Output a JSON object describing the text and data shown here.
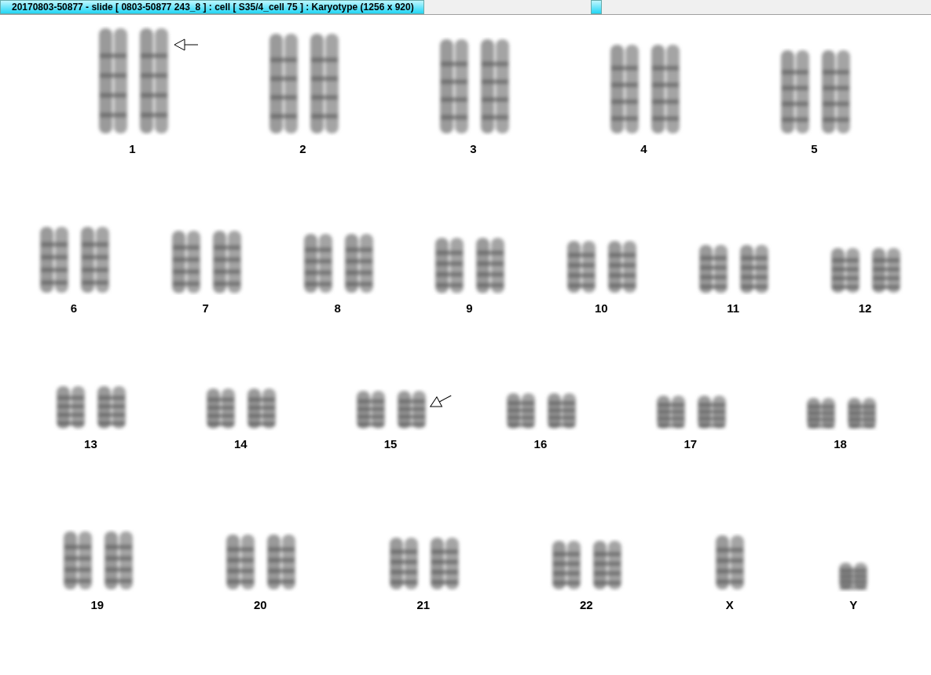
{
  "window": {
    "title": "20170803-50877 - slide [ 0803-50877 243_8 ] : cell [ S35/4_cell 75 ] : Karyotype  (1256 x 920)"
  },
  "karyotype": {
    "rows": [
      {
        "groups": [
          {
            "label": "1",
            "kind": "pair",
            "marked": true
          },
          {
            "label": "2",
            "kind": "pair",
            "marked": false
          },
          {
            "label": "3",
            "kind": "pair",
            "marked": false
          },
          {
            "label": "4",
            "kind": "pair",
            "marked": false
          },
          {
            "label": "5",
            "kind": "pair",
            "marked": false
          }
        ]
      },
      {
        "groups": [
          {
            "label": "6",
            "kind": "pair",
            "marked": false
          },
          {
            "label": "7",
            "kind": "pair",
            "marked": false
          },
          {
            "label": "8",
            "kind": "pair",
            "marked": false
          },
          {
            "label": "9",
            "kind": "pair",
            "marked": false
          },
          {
            "label": "10",
            "kind": "pair",
            "marked": false
          },
          {
            "label": "11",
            "kind": "pair",
            "marked": false
          },
          {
            "label": "12",
            "kind": "pair",
            "marked": false
          }
        ]
      },
      {
        "groups": [
          {
            "label": "13",
            "kind": "pair",
            "marked": false
          },
          {
            "label": "14",
            "kind": "pair",
            "marked": false
          },
          {
            "label": "15",
            "kind": "pair",
            "marked": true
          },
          {
            "label": "16",
            "kind": "pair",
            "marked": false
          },
          {
            "label": "17",
            "kind": "pair",
            "marked": false
          },
          {
            "label": "18",
            "kind": "pair",
            "marked": false
          }
        ]
      },
      {
        "groups": [
          {
            "label": "19",
            "kind": "pair",
            "marked": false
          },
          {
            "label": "20",
            "kind": "pair",
            "marked": false
          },
          {
            "label": "21",
            "kind": "pair",
            "marked": false
          },
          {
            "label": "22",
            "kind": "pair",
            "marked": false
          },
          {
            "label": "X",
            "kind": "single",
            "marked": false
          },
          {
            "label": "Y",
            "kind": "single",
            "marked": false
          }
        ]
      }
    ]
  }
}
